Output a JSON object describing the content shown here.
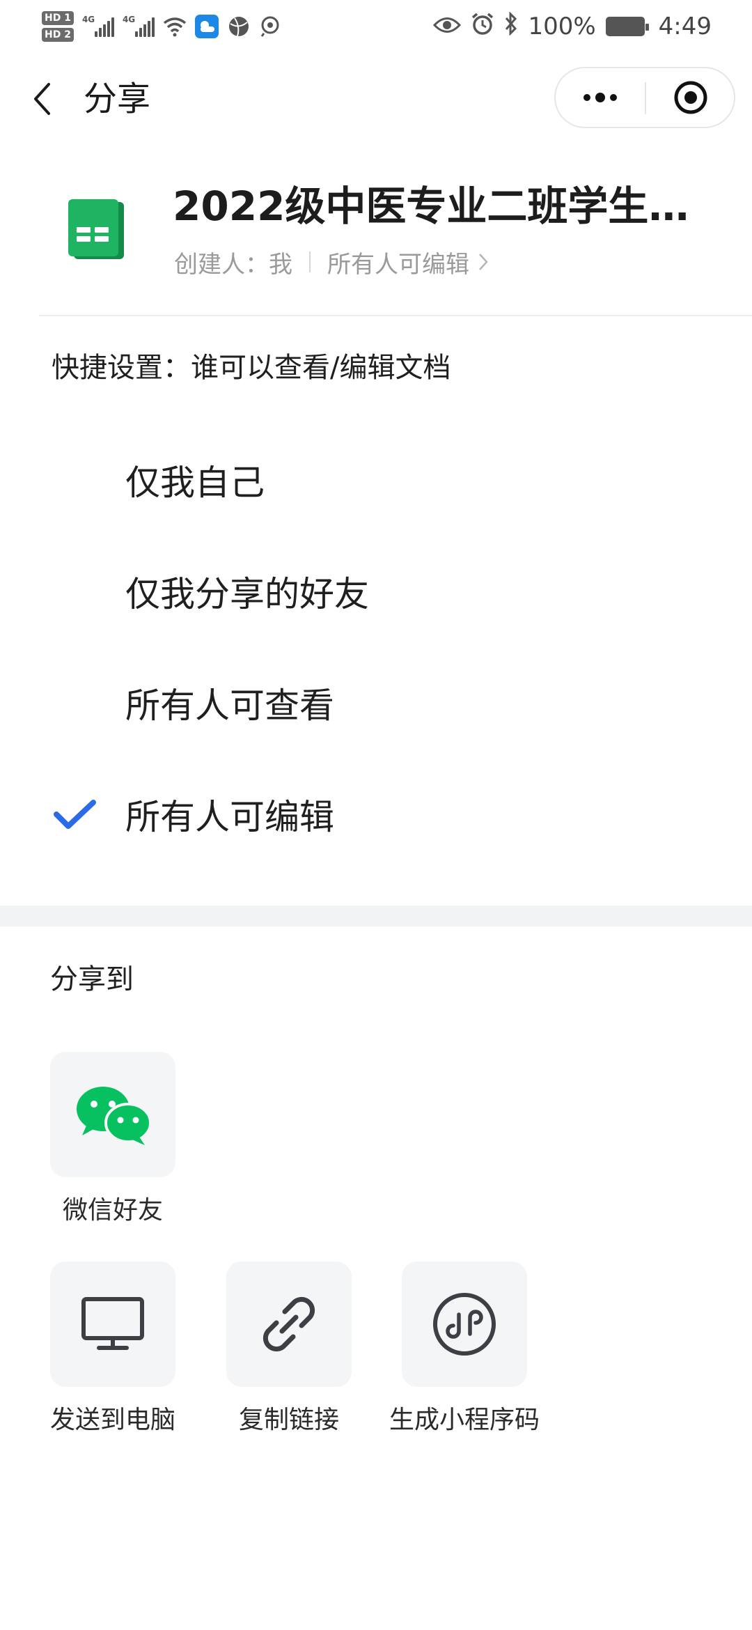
{
  "status_bar": {
    "sim1": "HD 1",
    "sim2": "HD 2",
    "net1": "4G",
    "net2": "4G",
    "battery": "100%",
    "time": "4:49"
  },
  "header": {
    "title": "分享"
  },
  "document": {
    "title": "2022级中医专业二班学生…",
    "creator": "创建人：我",
    "permission": "所有人可编辑",
    "icon_color": "#1fb462"
  },
  "quick_settings": {
    "label": "快捷设置：谁可以查看/编辑文档",
    "options": [
      {
        "label": "仅我自己",
        "selected": false
      },
      {
        "label": "仅我分享的好友",
        "selected": false
      },
      {
        "label": "所有人可查看",
        "selected": false
      },
      {
        "label": "所有人可编辑",
        "selected": true
      }
    ],
    "check_color": "#2b6be6"
  },
  "share": {
    "title": "分享到",
    "targets": [
      {
        "label": "微信好友",
        "icon": "wechat-icon"
      },
      {
        "label": "发送到电脑",
        "icon": "monitor-icon"
      },
      {
        "label": "复制链接",
        "icon": "link-icon"
      },
      {
        "label": "生成小程序码",
        "icon": "mini-program-icon"
      }
    ],
    "wechat_color": "#07c160"
  }
}
